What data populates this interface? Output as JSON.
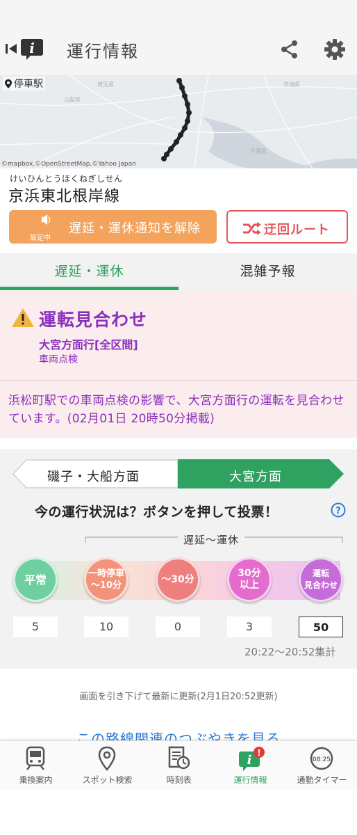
{
  "header": {
    "title": "運行情報"
  },
  "map": {
    "label": "停車駅",
    "credit": "©mapbox,©OpenStreetMap,©Yahoo Japan"
  },
  "line": {
    "kana": "けいひんとうほくねぎしせん",
    "name": "京浜東北根岸線"
  },
  "actions": {
    "notify_label": "遅延・運休通知を解除",
    "notify_sub": "設定中",
    "detour_label": "迂回ルート"
  },
  "tabs": [
    {
      "label": "遅延・運休"
    },
    {
      "label": "混雑予報"
    }
  ],
  "status": {
    "title": "運転見合わせ",
    "direction": "大宮方面行[全区間]",
    "cause": "車両点検",
    "detail": "浜松町駅での車両点検の影響で、大宮方面行の運転を見合わせています。(02月01日 20時50分掲載)"
  },
  "vote": {
    "dir_left": "磯子・大船方面",
    "dir_right": "大宮方面",
    "prompt": "今の運行状況は？ボタンを押して投票！",
    "range_label": "遅延〜運休",
    "options": [
      {
        "line1": "平常",
        "line2": "",
        "count": "5"
      },
      {
        "line1": "一時停車",
        "line2": "〜10分",
        "count": "10"
      },
      {
        "line1": "〜30分",
        "line2": "",
        "count": "0"
      },
      {
        "line1": "30分",
        "line2": "以上",
        "count": "3"
      },
      {
        "line1": "運転",
        "line2": "見合わせ",
        "count": "50"
      }
    ],
    "tally": "20:22〜20:52集計"
  },
  "footer": {
    "refresh_note": "画面を引き下げて最新に更新(2月1日20:52更新)",
    "tweet_link": "この路線関連のつぶやきを見る"
  },
  "nav": [
    {
      "label": "乗換案内",
      "icon": "train-icon"
    },
    {
      "label": "スポット検索",
      "icon": "map-pin-icon"
    },
    {
      "label": "時刻表",
      "icon": "timetable-icon"
    },
    {
      "label": "運行情報",
      "icon": "info-icon",
      "badge": "!"
    },
    {
      "label": "通勤タイマー",
      "icon": "timer-icon",
      "time": "08:25"
    }
  ],
  "colors": {
    "accent_green": "#2fa160",
    "status_purple": "#8a2fbf",
    "notify_orange": "#f3a35c",
    "detour_red": "#e2565a"
  }
}
